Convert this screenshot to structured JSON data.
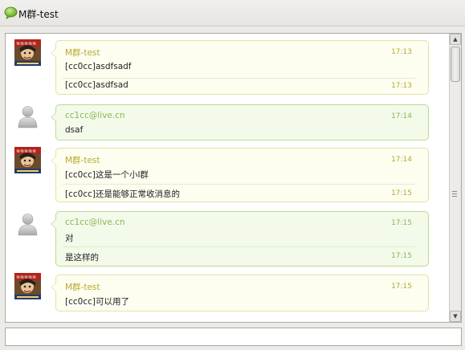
{
  "window": {
    "title": "M群-test",
    "icon": "chat-bubble-icon"
  },
  "colors": {
    "group_bubble_bg": "#fdfdf0",
    "group_bubble_border": "#e6e2a4",
    "group_name": "#b8aa30",
    "user_bubble_bg": "#f3faea",
    "user_bubble_border": "#b9dc8e",
    "user_name": "#8ab656"
  },
  "messages": [
    {
      "sender": "M群-test",
      "avatar": "anime-avatar-icon",
      "lines": [
        {
          "text": "[cc0cc]asdfsadf",
          "time": "17:13"
        },
        {
          "text": "[cc0cc]asdfsad",
          "time": "17:13"
        }
      ]
    },
    {
      "sender": "cc1cc@live.cn",
      "avatar": "default-user-icon",
      "lines": [
        {
          "text": "dsaf",
          "time": "17:14"
        }
      ]
    },
    {
      "sender": "M群-test",
      "avatar": "anime-avatar-icon",
      "lines": [
        {
          "text": "[cc0cc]这是一个小l群",
          "time": "17:14"
        },
        {
          "text": "[cc0cc]还是能够正常收消息的",
          "time": "17:15"
        }
      ]
    },
    {
      "sender": "cc1cc@live.cn",
      "avatar": "default-user-icon",
      "lines": [
        {
          "text": "对",
          "time": "17:15"
        },
        {
          "text": "是这样的",
          "time": "17:15"
        }
      ]
    },
    {
      "sender": "M群-test",
      "avatar": "anime-avatar-icon",
      "lines": [
        {
          "text": "[cc0cc]可以用了",
          "time": "17:15"
        }
      ]
    }
  ],
  "input": {
    "value": ""
  }
}
